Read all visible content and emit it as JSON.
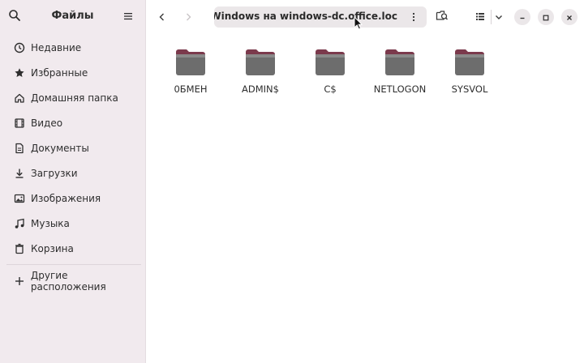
{
  "sidebar": {
    "title": "Файлы",
    "items": [
      {
        "label": "Недавние",
        "icon": "clock-icon"
      },
      {
        "label": "Избранные",
        "icon": "star-icon"
      },
      {
        "label": "Домашняя папка",
        "icon": "home-icon"
      },
      {
        "label": "Видео",
        "icon": "film-icon"
      },
      {
        "label": "Документы",
        "icon": "document-icon"
      },
      {
        "label": "Загрузки",
        "icon": "download-icon"
      },
      {
        "label": "Изображения",
        "icon": "image-icon"
      },
      {
        "label": "Музыка",
        "icon": "music-icon"
      },
      {
        "label": "Корзина",
        "icon": "trash-icon"
      }
    ],
    "other_locations": {
      "label": "Другие расположения",
      "icon": "plus-icon"
    }
  },
  "header": {
    "path": "Общие ресурсы Windows на windows-dc.office.loc"
  },
  "folders": [
    {
      "name": "0БМЕН"
    },
    {
      "name": "ADMIN$"
    },
    {
      "name": "C$"
    },
    {
      "name": "NETLOGON"
    },
    {
      "name": "SYSVOL"
    }
  ],
  "colors": {
    "sidebar_bg": "#f1eaee",
    "folder_tab": "#7b3a4c",
    "folder_body": "#6d6d6d"
  }
}
